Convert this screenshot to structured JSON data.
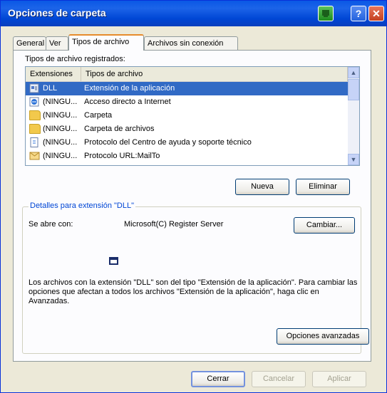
{
  "window": {
    "title": "Opciones de carpeta",
    "help_glyph": "?",
    "close_glyph": "✕"
  },
  "tabs": [
    {
      "label": "General",
      "active": false
    },
    {
      "label": "Ver",
      "active": false
    },
    {
      "label": "Tipos de archivo",
      "active": true
    },
    {
      "label": "Archivos sin conexión",
      "active": false
    }
  ],
  "file_types": {
    "section_label": "Tipos de archivo registrados:",
    "columns": [
      "Extensiones",
      "Tipos de archivo"
    ],
    "rows": [
      {
        "ext": "DLL",
        "type": "Extensión de la aplicación",
        "icon": "dll-icon",
        "selected": true
      },
      {
        "ext": "(NINGU...",
        "type": "Acceso directo a Internet",
        "icon": "internet-shortcut-icon",
        "selected": false
      },
      {
        "ext": "(NINGU...",
        "type": "Carpeta",
        "icon": "folder-icon",
        "selected": false
      },
      {
        "ext": "(NINGU...",
        "type": "Carpeta de archivos",
        "icon": "folder-icon",
        "selected": false
      },
      {
        "ext": "(NINGU...",
        "type": "Protocolo del Centro de ayuda y soporte técnico",
        "icon": "help-file-icon",
        "selected": false
      },
      {
        "ext": "(NINGU...",
        "type": "Protocolo URL:MailTo",
        "icon": "mailto-icon",
        "selected": false
      }
    ]
  },
  "buttons": {
    "new": "Nueva",
    "delete": "Eliminar",
    "change": "Cambiar...",
    "advanced": "Opciones avanzadas",
    "close": "Cerrar",
    "cancel": "Cancelar",
    "apply": "Aplicar"
  },
  "details": {
    "group_title": "Detalles para extensión \"DLL\"",
    "opens_with_label": "Se abre con:",
    "opens_with_value": "Microsoft(C) Register Server",
    "description": "Los archivos con la extensión \"DLL\" son del tipo \"Extensión de la aplicación\". Para cambiar las opciones que afectan a todos los archivos \"Extensión de la aplicación\", haga clic en Avanzadas."
  }
}
